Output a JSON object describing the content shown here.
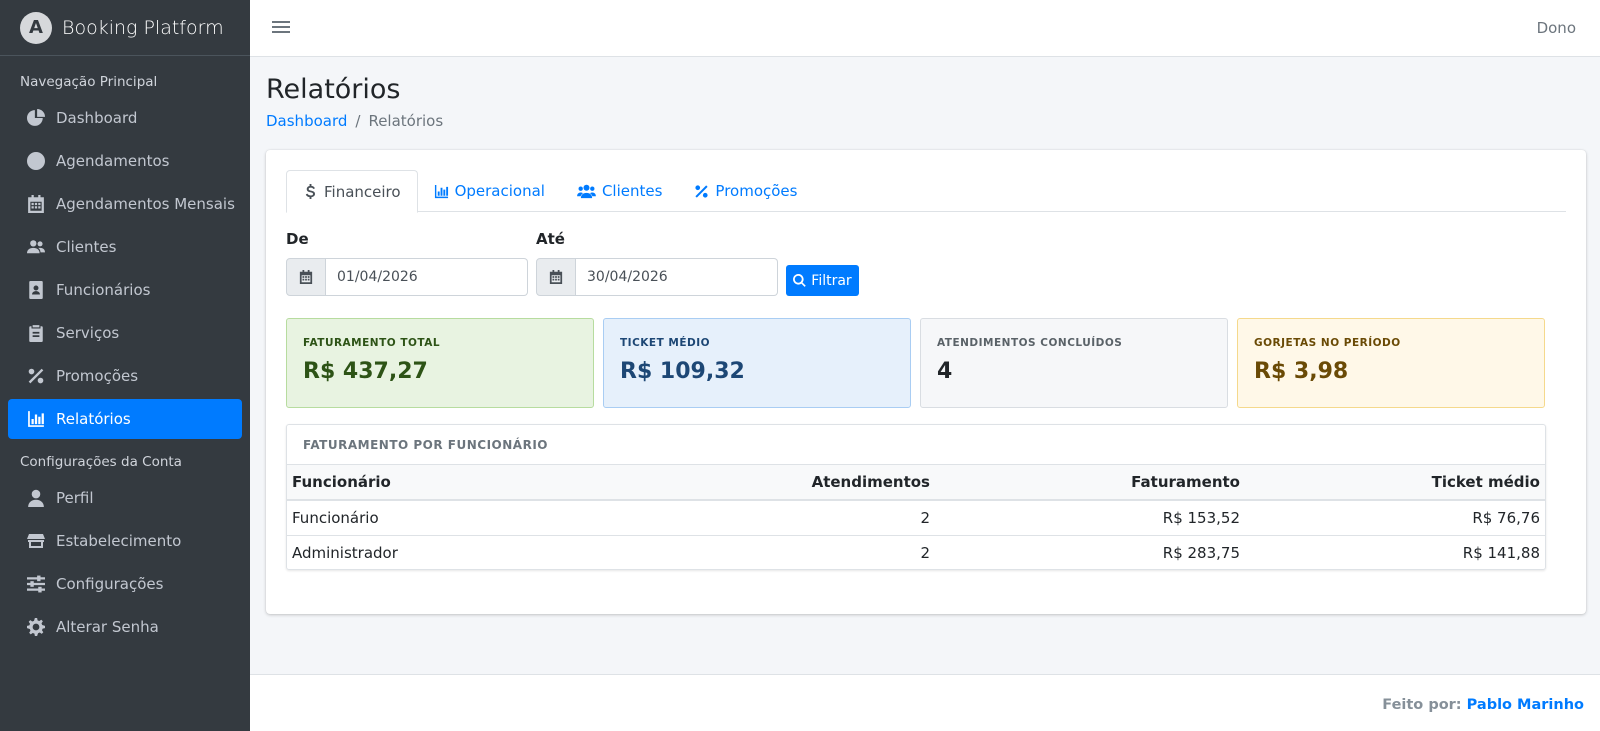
{
  "app": {
    "brand": "Booking Platform",
    "user": "Dono"
  },
  "sidebar": {
    "header_main": "Navegação Principal",
    "items": [
      {
        "label": "Dashboard",
        "icon": "chart-pie-icon"
      },
      {
        "label": "Agendamentos",
        "icon": "clock-icon"
      },
      {
        "label": "Agendamentos Mensais",
        "icon": "calendar-icon"
      },
      {
        "label": "Clientes",
        "icon": "users-icon"
      },
      {
        "label": "Funcionários",
        "icon": "id-badge-icon"
      },
      {
        "label": "Serviços",
        "icon": "clipboard-icon"
      },
      {
        "label": "Promoções",
        "icon": "percent-icon"
      },
      {
        "label": "Relatórios",
        "icon": "chart-bar-icon",
        "active": true
      }
    ],
    "header_account": "Configurações da Conta",
    "account_items": [
      {
        "label": "Perfil",
        "icon": "user-icon"
      },
      {
        "label": "Estabelecimento",
        "icon": "store-icon"
      },
      {
        "label": "Configurações",
        "icon": "sliders-icon"
      },
      {
        "label": "Alterar Senha",
        "icon": "gear-icon"
      }
    ]
  },
  "page": {
    "title": "Relatórios",
    "breadcrumb": {
      "home": "Dashboard",
      "sep": "/",
      "current": "Relatórios"
    }
  },
  "tabs": [
    {
      "label": "Financeiro",
      "icon": "dollar-icon",
      "active": true
    },
    {
      "label": "Operacional",
      "icon": "chart-bar-icon"
    },
    {
      "label": "Clientes",
      "icon": "users-icon"
    },
    {
      "label": "Promoções",
      "icon": "percent-icon"
    }
  ],
  "filters": {
    "from_label": "De",
    "from_value": "01/04/2026",
    "to_label": "Até",
    "to_value": "30/04/2026",
    "button": "Filtrar"
  },
  "stats": [
    {
      "label": "Faturamento total",
      "value": "R$ 437,27",
      "color": "#e8f3e1"
    },
    {
      "label": "Ticket médio",
      "value": "R$ 109,32",
      "color": "#e6f0fb"
    },
    {
      "label": "Atendimentos concluídos",
      "value": "4",
      "color": "#f6f7f9"
    },
    {
      "label": "Gorjetas no período",
      "value": "R$ 3,98",
      "color": "#fff8e8"
    }
  ],
  "employee_table": {
    "title": "Faturamento por funcionário",
    "columns": [
      "Funcionário",
      "Atendimentos",
      "Faturamento",
      "Ticket médio"
    ],
    "rows": [
      [
        "Funcionário",
        "2",
        "R$ 153,52",
        "R$ 76,76"
      ],
      [
        "Administrador",
        "2",
        "R$ 283,75",
        "R$ 141,88"
      ]
    ]
  },
  "footer": {
    "prefix": "Feito por:",
    "author": "Pablo Marinho"
  },
  "colors": {
    "primary": "#007bff",
    "sidebar_bg": "#343a40"
  }
}
